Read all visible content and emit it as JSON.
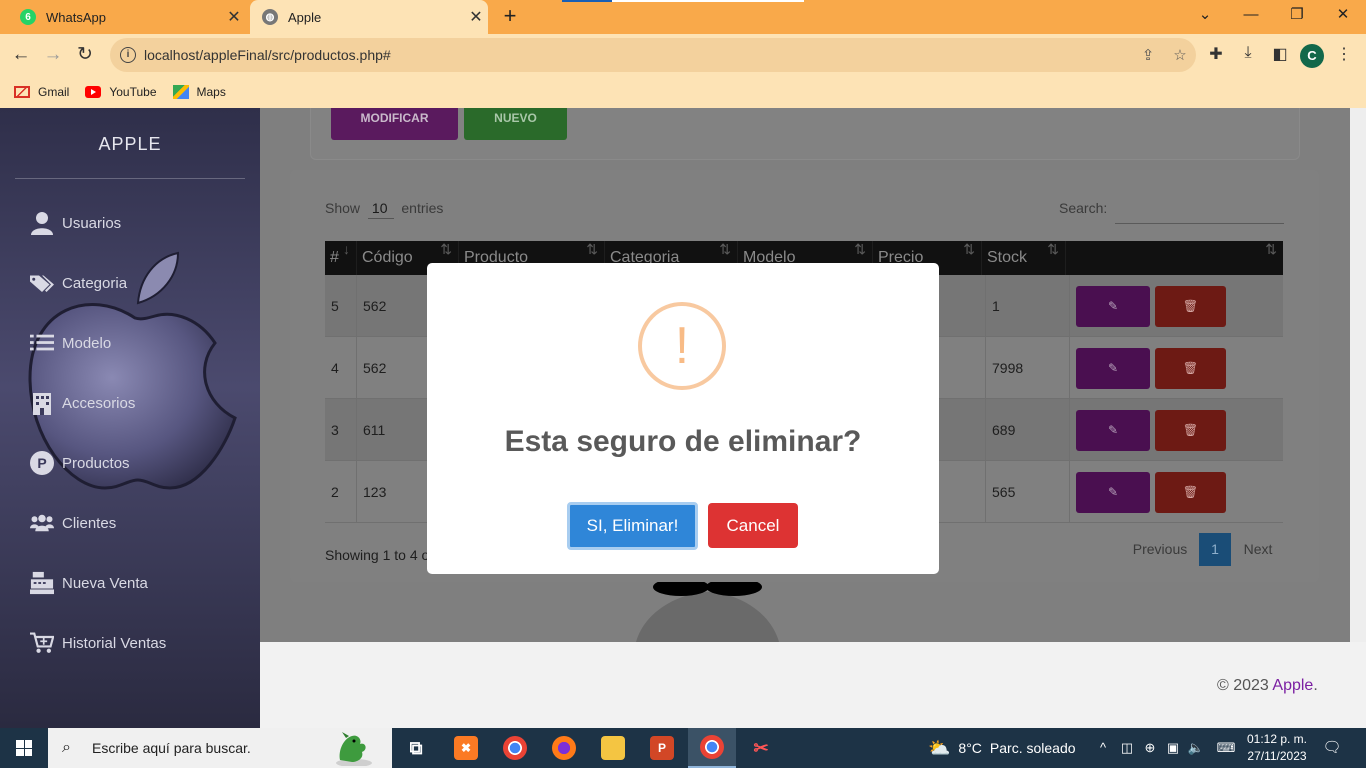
{
  "browser": {
    "tabs": [
      {
        "label": "WhatsApp",
        "badge": "6",
        "icon": "whatsapp-icon"
      },
      {
        "label": "Apple",
        "icon": "globe-icon"
      }
    ],
    "new_tab": "+",
    "window_controls": {
      "minimize": "—",
      "restore": "❐",
      "close": "✕",
      "tabsearch": "⌄"
    },
    "url": "localhost/appleFinal/src/productos.php#",
    "profile_initial": "C",
    "bookmarks": [
      {
        "label": "Gmail",
        "icon": "gmail-icon"
      },
      {
        "label": "YouTube",
        "icon": "youtube-icon"
      },
      {
        "label": "Maps",
        "icon": "maps-icon"
      }
    ]
  },
  "app": {
    "brand": "APPLE",
    "nav": [
      {
        "label": "Usuarios",
        "icon": "user-icon"
      },
      {
        "label": "Categoria",
        "icon": "tags-icon"
      },
      {
        "label": "Modelo",
        "icon": "list-icon"
      },
      {
        "label": "Accesorios",
        "icon": "building-icon"
      },
      {
        "label": "Productos",
        "icon": "product-p-icon"
      },
      {
        "label": "Clientes",
        "icon": "users-icon"
      },
      {
        "label": "Nueva Venta",
        "icon": "cash-register-icon"
      },
      {
        "label": "Historial Ventas",
        "icon": "cart-plus-icon"
      }
    ],
    "actions": {
      "modify": "MODIFICAR",
      "new": "NUEVO"
    },
    "table": {
      "length_label_pre": "Show",
      "length_value": "10",
      "length_label_post": "entries",
      "search_label": "Search:",
      "columns": [
        "#",
        "Código",
        "Producto",
        "Categoria",
        "Modelo",
        "Precio",
        "Stock",
        ""
      ],
      "rows": [
        {
          "id": "5",
          "codigo": "562",
          "stock": "1"
        },
        {
          "id": "4",
          "codigo": "562",
          "stock": "7998"
        },
        {
          "id": "3",
          "codigo": "611",
          "stock": "689"
        },
        {
          "id": "2",
          "codigo": "123",
          "stock": "565"
        }
      ],
      "info": "Showing 1 to 4 o",
      "pagination": {
        "previous": "Previous",
        "current": "1",
        "next": "Next"
      }
    },
    "footer": {
      "copyright": "© 2023",
      "brand": "Apple",
      "dot": "."
    }
  },
  "modal": {
    "icon_glyph": "!",
    "title": "Esta seguro de eliminar?",
    "confirm": "SI, Eliminar!",
    "cancel": "Cancel"
  },
  "taskbar": {
    "search_placeholder": "Escribe aquí para buscar.",
    "weather_temp": "8°C",
    "weather_text": "Parc. soleado",
    "time": "01:12 p. m.",
    "date": "27/11/2023"
  },
  "colors": {
    "browser_orange": "#f9a94a",
    "confirm_blue": "#2f86d8",
    "cancel_red": "#dd3333",
    "edit_purple": "#8e24aa",
    "delete_red": "#d32f2f",
    "warning_orange": "#f8bb86"
  }
}
